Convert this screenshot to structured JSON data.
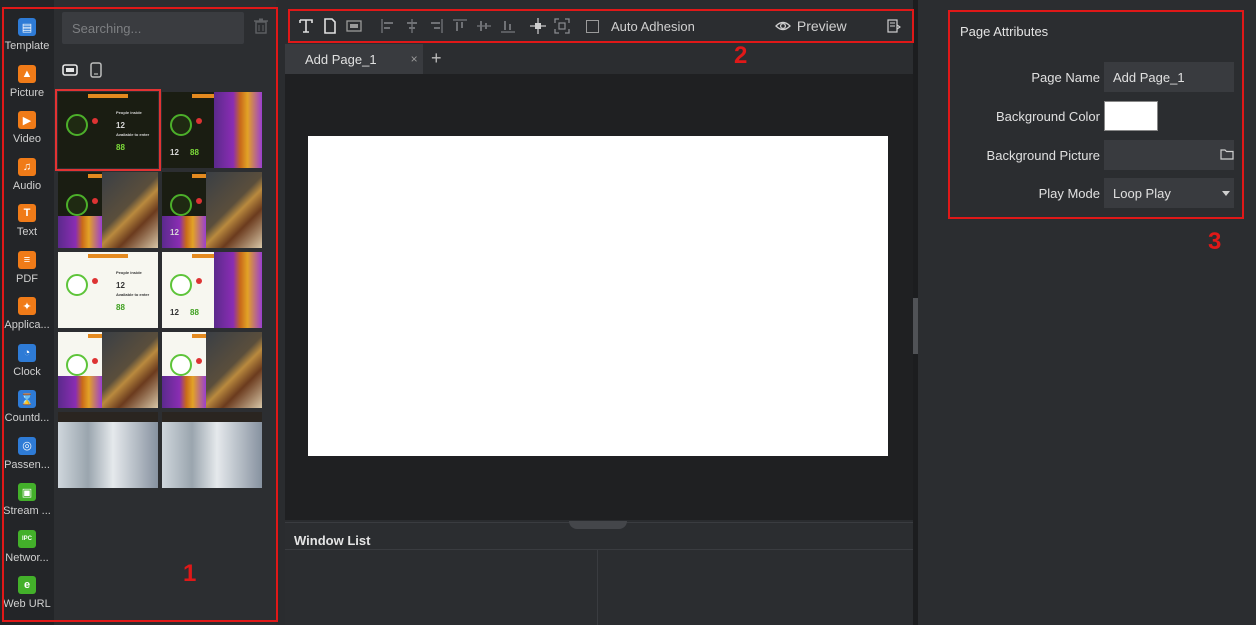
{
  "rail": {
    "items": [
      {
        "label": "Template",
        "icon": "template-icon",
        "color": "#2e7bd6"
      },
      {
        "label": "Picture",
        "icon": "picture-icon",
        "color": "#f07b18"
      },
      {
        "label": "Video",
        "icon": "video-icon",
        "color": "#f07b18"
      },
      {
        "label": "Audio",
        "icon": "audio-icon",
        "color": "#f07b18"
      },
      {
        "label": "Text",
        "icon": "text-icon",
        "color": "#f07b18"
      },
      {
        "label": "PDF",
        "icon": "pdf-icon",
        "color": "#f07b18"
      },
      {
        "label": "Applica...",
        "icon": "application-icon",
        "color": "#f07b18"
      },
      {
        "label": "Clock",
        "icon": "clock-icon",
        "color": "#2e7bd6"
      },
      {
        "label": "Countd...",
        "icon": "countdown-icon",
        "color": "#2e7bd6"
      },
      {
        "label": "Passen...",
        "icon": "passenger-icon",
        "color": "#2e7bd6"
      },
      {
        "label": "Stream ...",
        "icon": "stream-icon",
        "color": "#43b02a"
      },
      {
        "label": "Networ...",
        "icon": "network-ipc-icon",
        "color": "#43b02a"
      },
      {
        "label": "Web URL",
        "icon": "web-url-icon",
        "color": "#43b02a"
      }
    ]
  },
  "panel": {
    "search_placeholder": "Searching...",
    "templates": [
      {
        "style": "dark",
        "texts": [
          "People inside",
          "12",
          "Available to enter",
          "88"
        ]
      },
      {
        "style": "dark-face",
        "texts": [
          "12",
          "88"
        ]
      },
      {
        "style": "dark-burger",
        "texts": []
      },
      {
        "style": "dark-burger-2",
        "texts": [
          "12"
        ]
      },
      {
        "style": "light",
        "texts": [
          "People inside",
          "12",
          "Available to enter",
          "88"
        ]
      },
      {
        "style": "light-face",
        "texts": [
          "12",
          "88"
        ]
      },
      {
        "style": "light-burger",
        "texts": []
      },
      {
        "style": "light-burger-2",
        "texts": []
      },
      {
        "style": "office",
        "texts": []
      },
      {
        "style": "office-2",
        "texts": []
      }
    ]
  },
  "toolbar": {
    "auto_adhesion_label": "Auto Adhesion",
    "preview_label": "Preview"
  },
  "tabs": {
    "active_label": "Add Page_1",
    "close_glyph": "×",
    "add_glyph": "+"
  },
  "window_list": {
    "title": "Window List"
  },
  "attributes": {
    "title": "Page Attributes",
    "page_name_label": "Page Name",
    "page_name_value": "Add Page_1",
    "background_color_label": "Background Color",
    "background_color_value": "#ffffff",
    "background_picture_label": "Background Picture",
    "background_picture_value": "",
    "play_mode_label": "Play Mode",
    "play_mode_value": "Loop Play"
  },
  "annotations": {
    "one": "1",
    "two": "2",
    "three": "3",
    "color": "#e01818"
  }
}
